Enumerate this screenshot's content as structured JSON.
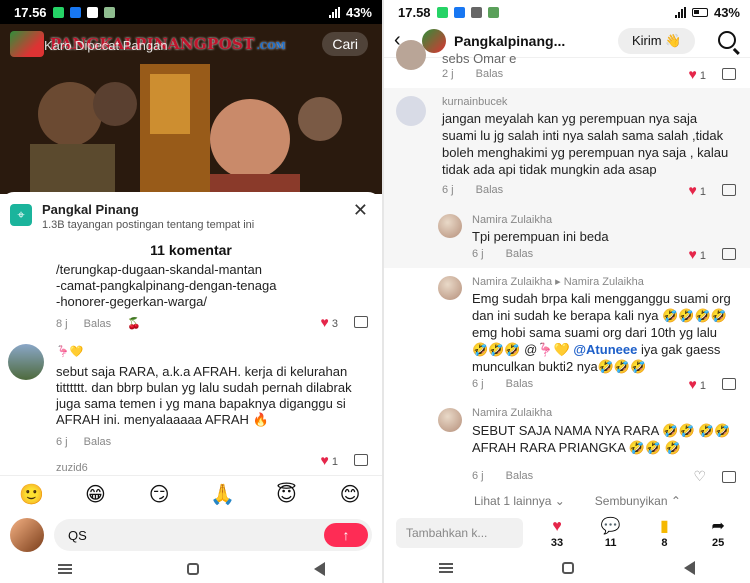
{
  "left": {
    "status": {
      "time": "17.56",
      "battery": "43%"
    },
    "header": {
      "logo_text": "PANGKALPINANGPOST",
      "logo_suffix": ".COM",
      "search_text": "Karo Dipecat Pangan",
      "search_button": "Cari"
    },
    "location": {
      "name": "Pangkal Pinang",
      "views": "1.3B tayangan postingan tentang tempat ini"
    },
    "comment_count": "11 komentar",
    "comments": [
      {
        "text": "/terungkap-dugaan-skandal-mantan\n-camat-pangkalpinang-dengan-tenaga\n-honorer-gegerkan-warga/",
        "time": "8 j",
        "reply": "Balas",
        "likes": "3"
      },
      {
        "username": "🦩💛",
        "text": "sebut saja RARA, a.k.a AFRAH. kerja di kelurahan titttttt. dan bbrp bulan yg lalu sudah pernah dilabrak juga sama temen i yg mana bapaknya diganggu si AFRAH ini. menyalaaaaa AFRAH 🔥",
        "time": "6 j",
        "reply": "Balas",
        "likes": "1"
      },
      {
        "username": "zuzid6"
      }
    ],
    "emoji_bar": [
      "🙂",
      "😁",
      "😏",
      "🙏",
      "😇",
      "😊"
    ],
    "input_value": "QS",
    "send_icon": "↑"
  },
  "right": {
    "status": {
      "time": "17.58",
      "battery": "43%"
    },
    "header": {
      "title": "Pangkalpinang...",
      "kirim": "Kirim 👋"
    },
    "comments": [
      {
        "text": "sebs Omar e",
        "time": "2 j",
        "reply": "Balas",
        "likes": "1"
      },
      {
        "username": "kurnainbucek",
        "text": "jangan meyalah kan yg perempuan nya saja suami lu jg salah inti nya salah sama salah ,tidak boleh menghakimi yg perempuan nya saja , kalau tidak ada api tidak mungkin ada asap",
        "time": "6 j",
        "reply": "Balas",
        "likes": "1"
      },
      {
        "username": "Namira Zulaikha",
        "text": "Tpi perempuan ini beda",
        "time": "6 j",
        "reply": "Balas",
        "likes": "1"
      },
      {
        "username": "Namira Zulaikha",
        "reply_to": "▸ Namira Zulaikha",
        "text_before": "Emg sudah brpa kali mengganggu suami org dan ini sudah ke berapa kali nya 🤣🤣🤣🤣 emg hobi sama suami org dari 10th yg lalu 🤣🤣🤣 @🦩💛 ",
        "mention": "@Atuneee",
        "text_after": " iya gak gaess munculkan bukti2 nya🤣🤣🤣",
        "time": "6 j",
        "reply": "Balas",
        "likes": "1"
      },
      {
        "username": "Namira Zulaikha",
        "text": "SEBUT SAJA NAMA NYA RARA 🤣🤣 🤣🤣 AFRAH RARA PRIANGKA 🤣🤣 🤣",
        "time": "6 j",
        "reply": "Balas",
        "likes": ""
      }
    ],
    "more": {
      "show_more": "Lihat 1 lainnya ⌄",
      "hide": "Sembunyikan ⌃"
    },
    "bottom": {
      "input_placeholder": "Tambahkan k...",
      "likes": "33",
      "comments": "11",
      "saves": "8",
      "shares": "25"
    }
  }
}
